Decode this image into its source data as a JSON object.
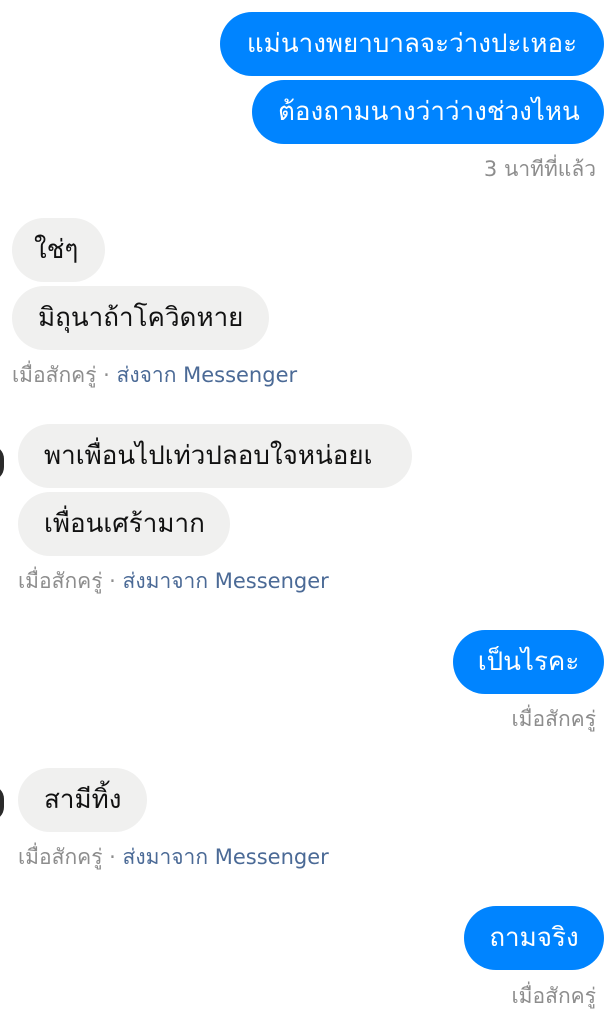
{
  "outgoing_group_1": {
    "messages": [
      "แม่นางพยาบาลจะว่างปะเหอะ",
      "ต้องถามนางว่าว่างช่วงไหน"
    ],
    "timestamp": "3 นาทีที่แล้ว"
  },
  "incoming_group_1": {
    "messages": [
      "ใช่ๆ",
      "มิถุนาถ้าโควิดหาย"
    ],
    "meta_time": "เมื่อสักครู่",
    "meta_separator": " · ",
    "meta_source": "ส่งจาก Messenger"
  },
  "incoming_group_2": {
    "messages": [
      "พาเพื่อนไปเท่วปลอบใจหน่อยเ",
      "เพื่อนเศร้ามาก"
    ],
    "meta_time": "เมื่อสักครู่",
    "meta_separator": " · ",
    "meta_source": "ส่งมาจาก Messenger"
  },
  "outgoing_group_2": {
    "message": "เป็นไรคะ",
    "timestamp": "เมื่อสักครู่"
  },
  "incoming_group_3": {
    "message": "สามีทิ้ง",
    "meta_time": "เมื่อสักครู่",
    "meta_separator": " · ",
    "meta_source": "ส่งมาจาก Messenger"
  },
  "outgoing_group_3": {
    "message": "ถามจริง",
    "timestamp": "เมื่อสักครู่"
  },
  "colors": {
    "outgoing_bubble": "#0084ff",
    "incoming_bubble": "#f0f0ef",
    "meta_text": "#8d8d8d",
    "source_link": "#4b6a96"
  }
}
